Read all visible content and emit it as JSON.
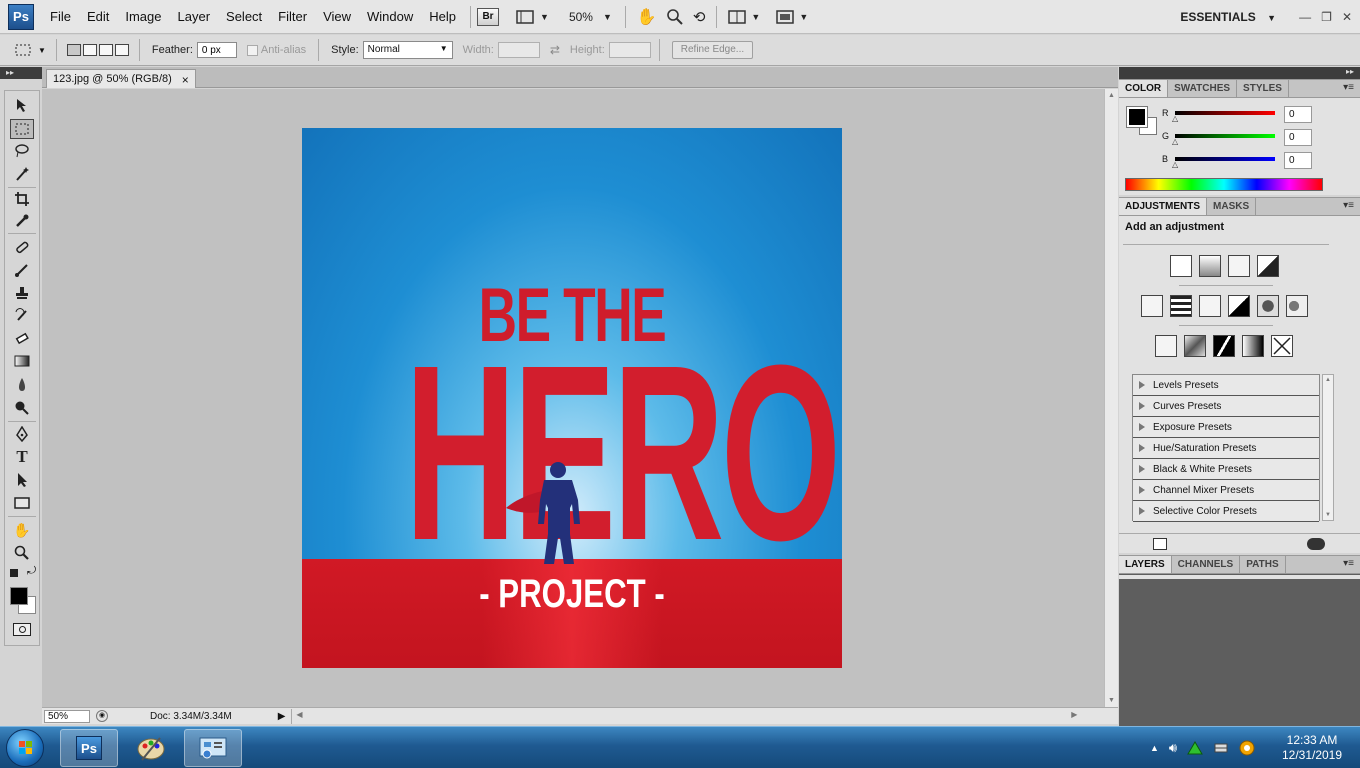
{
  "app": {
    "logo": "Ps",
    "workspace": "ESSENTIALS"
  },
  "menu": [
    "File",
    "Edit",
    "Image",
    "Layer",
    "Select",
    "Filter",
    "View",
    "Window",
    "Help"
  ],
  "menubar_tools": {
    "bridge": "Br",
    "zoom": "50%"
  },
  "options": {
    "feather_label": "Feather:",
    "feather_value": "0 px",
    "antialias_label": "Anti-alias",
    "style_label": "Style:",
    "style_value": "Normal",
    "width_label": "Width:",
    "height_label": "Height:",
    "refine_label": "Refine Edge..."
  },
  "document": {
    "tab_title": "123.jpg @ 50% (RGB/8)",
    "close_glyph": "×",
    "status_zoom": "50%",
    "status_doc": "Doc: 3.34M/3.34M"
  },
  "artwork": {
    "line1": "BE THE",
    "line2": "HERO",
    "line3": "- PROJECT -"
  },
  "color_panel": {
    "tabs": [
      "COLOR",
      "SWATCHES",
      "STYLES"
    ],
    "channels": [
      {
        "label": "R",
        "value": "0"
      },
      {
        "label": "G",
        "value": "0"
      },
      {
        "label": "B",
        "value": "0"
      }
    ]
  },
  "adjustments_panel": {
    "tabs": [
      "ADJUSTMENTS",
      "MASKS"
    ],
    "heading": "Add an adjustment",
    "presets": [
      "Levels Presets",
      "Curves Presets",
      "Exposure Presets",
      "Hue/Saturation Presets",
      "Black & White Presets",
      "Channel Mixer Presets",
      "Selective Color Presets"
    ]
  },
  "layers_panel": {
    "tabs": [
      "LAYERS",
      "CHANNELS",
      "PATHS"
    ]
  },
  "taskbar": {
    "clock_time": "12:33 AM",
    "clock_date": "12/31/2019",
    "ps_label": "Ps"
  },
  "colors": {
    "accent": "#1d4f8c",
    "hero_red": "#d21e2d",
    "sky_blue": "#1e8ed3"
  }
}
